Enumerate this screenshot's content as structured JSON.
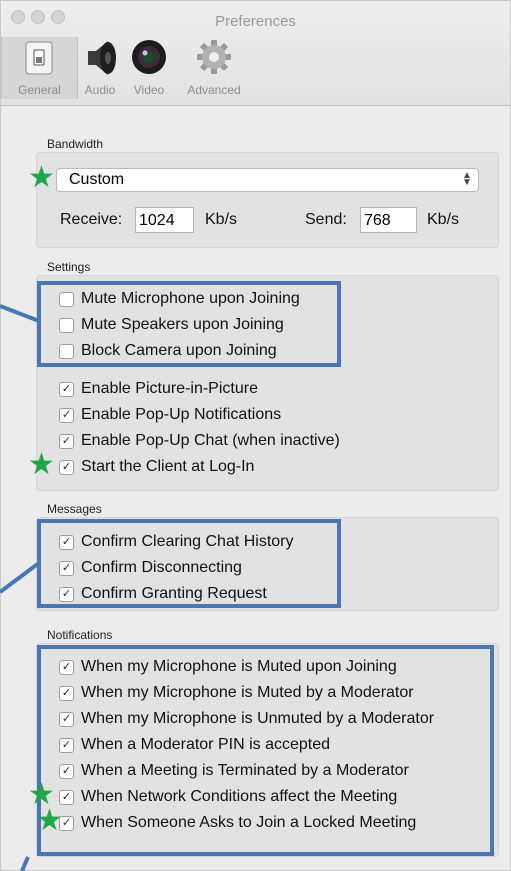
{
  "window": {
    "title": "Preferences",
    "toolbar": [
      {
        "label": "General",
        "icon": "switch-icon",
        "selected": true
      },
      {
        "label": "Audio",
        "icon": "speaker-icon",
        "selected": false
      },
      {
        "label": "Video",
        "icon": "camera-lens-icon",
        "selected": false
      },
      {
        "label": "Advanced",
        "icon": "gear-icon",
        "selected": false
      }
    ]
  },
  "bandwidth": {
    "label": "Bandwidth",
    "selected": "Custom",
    "receive_label": "Receive:",
    "receive_value": "1024",
    "receive_unit": "Kb/s",
    "send_label": "Send:",
    "send_value": "768",
    "send_unit": "Kb/s"
  },
  "settings": {
    "label": "Settings",
    "items": [
      {
        "label": "Mute Microphone upon Joining",
        "checked": false
      },
      {
        "label": "Mute Speakers upon Joining",
        "checked": false
      },
      {
        "label": "Block Camera upon Joining",
        "checked": false
      },
      {
        "label": "Enable Picture-in-Picture",
        "checked": true
      },
      {
        "label": "Enable Pop-Up Notifications",
        "checked": true
      },
      {
        "label": "Enable Pop-Up Chat (when inactive)",
        "checked": true
      },
      {
        "label": "Start the Client at Log-In",
        "checked": true
      }
    ]
  },
  "messages": {
    "label": "Messages",
    "items": [
      {
        "label": "Confirm Clearing Chat History",
        "checked": true
      },
      {
        "label": "Confirm Disconnecting",
        "checked": true
      },
      {
        "label": "Confirm Granting Request",
        "checked": true
      }
    ]
  },
  "notifications": {
    "label": "Notifications",
    "items": [
      {
        "label": "When my Microphone is Muted upon Joining",
        "checked": true
      },
      {
        "label": "When my Microphone is Muted by a Moderator",
        "checked": true
      },
      {
        "label": "When my Microphone is Unmuted by a Moderator",
        "checked": true
      },
      {
        "label": "When a Moderator PIN is accepted",
        "checked": true
      },
      {
        "label": "When a Meeting is Terminated by a Moderator",
        "checked": true
      },
      {
        "label": "When Network Conditions affect the Meeting",
        "checked": true
      },
      {
        "label": "When Someone Asks to Join a Locked Meeting",
        "checked": true
      }
    ]
  },
  "colors": {
    "annotation_box": "#4a77b4",
    "annotation_star": "#22a64a"
  }
}
